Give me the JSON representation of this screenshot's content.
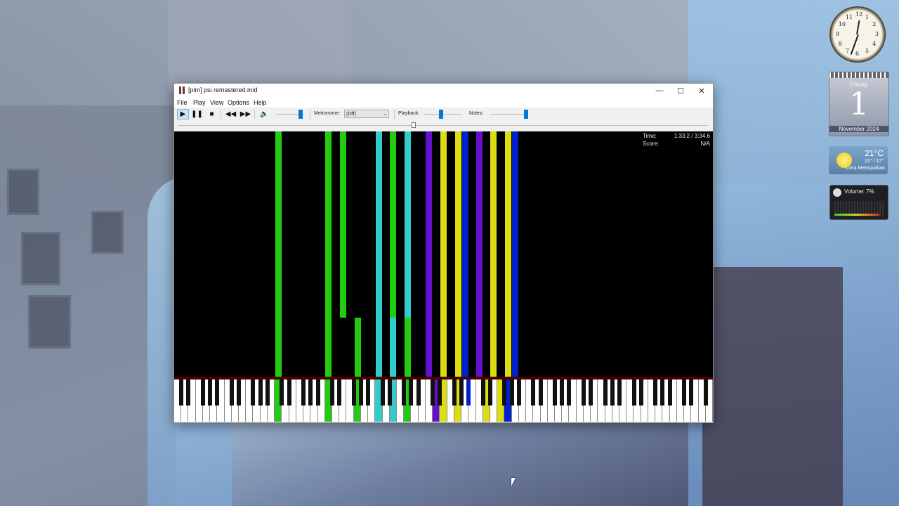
{
  "window": {
    "title": "[plm] psi remastered.mid",
    "controls": {
      "minimize": "—",
      "maximize": "☐",
      "close": "✕"
    }
  },
  "menu": [
    "File",
    "Play",
    "View",
    "Options",
    "Help"
  ],
  "toolbar": {
    "play_icon": "play-icon",
    "pause_icon": "pause-icon",
    "stop_icon": "stop-icon",
    "rewind_icon": "rewind-icon",
    "forward_icon": "fast-forward-icon",
    "volume_icon": "speaker-icon",
    "metronome_label": "Metronome:",
    "metronome_value": "(Off)",
    "playback_label": "Playback:",
    "notes_label": "Notes:",
    "volume_level": 0.95,
    "playback_level": 0.45,
    "notes_level": 1.0
  },
  "seek": {
    "progress": 0.44
  },
  "info": {
    "time_label": "Time:",
    "time_value": "1:33.2 / 3:34.6",
    "score_label": "Score:",
    "score_value": "N/A"
  },
  "colors": {
    "green": "#22cc11",
    "cyan": "#33cccc",
    "purple": "#6611cc",
    "yellow": "#dddd11",
    "blue": "#0022cc"
  },
  "gadgets": {
    "clock_time": "12:34",
    "calendar": {
      "day": "Friday",
      "date": "1",
      "month_year": "November 2024"
    },
    "weather": {
      "temp": "21°C",
      "range": "21° / 17°",
      "city": "Lima Metropolitan",
      "icon": "sun-icon"
    },
    "volume": {
      "label": "Volume: 7%"
    }
  }
}
